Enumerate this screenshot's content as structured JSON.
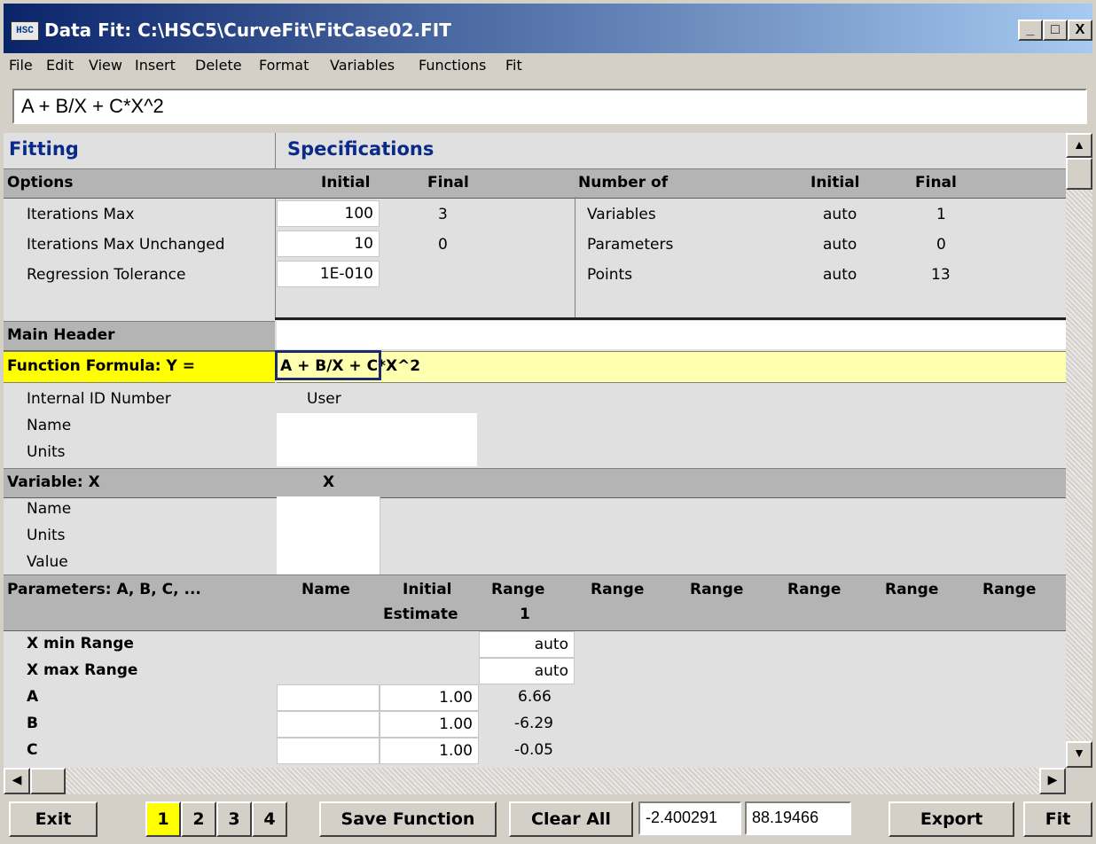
{
  "window": {
    "title": "Data Fit: C:\\HSC5\\CurveFit\\FitCase02.FIT",
    "app_icon": "HSC",
    "min": "_",
    "max": "□",
    "close": "X"
  },
  "menu": [
    "File",
    "Edit",
    "View",
    "Insert",
    "Delete",
    "Format",
    "Variables",
    "Functions",
    "Fit"
  ],
  "formula_bar": "A + B/X + C*X^2",
  "fitting": {
    "title_left": "Fitting",
    "title_right": "Specifications",
    "options_label": "Options",
    "col_initial": "Initial",
    "col_final": "Final",
    "rows": [
      {
        "label": "Iterations Max",
        "initial": "100",
        "final": "3"
      },
      {
        "label": "Iterations Max Unchanged",
        "initial": "10",
        "final": "0"
      },
      {
        "label": "Regression Tolerance",
        "initial": "1E-010",
        "final": ""
      }
    ],
    "number_of_label": "Number of",
    "number_rows": [
      {
        "label": "Variables",
        "initial": "auto",
        "final": "1"
      },
      {
        "label": "Parameters",
        "initial": "auto",
        "final": "0"
      },
      {
        "label": "Points",
        "initial": "auto",
        "final": "13"
      }
    ]
  },
  "main_header": {
    "label": "Main Header",
    "value": ""
  },
  "function": {
    "label": "Function Formula:  Y =",
    "formula": "A + B/X + C*X^2",
    "id_label": "Internal ID Number",
    "id_value": "User",
    "name_label": "Name",
    "units_label": "Units"
  },
  "variable": {
    "label": "Variable: X",
    "value": "X",
    "name_label": "Name",
    "units_label": "Units",
    "value_label": "Value"
  },
  "parameters": {
    "label": "Parameters: A, B, C, ...",
    "h_name": "Name",
    "h_initial": "Initial",
    "h_estimate": "Estimate",
    "h_range": "Range",
    "h_range_num": "1",
    "xmin_label": "X min Range",
    "xmin_value": "auto",
    "xmax_label": "X max Range",
    "xmax_value": "auto",
    "rows": [
      {
        "label": "A",
        "initial": "1.00",
        "range1": "6.66"
      },
      {
        "label": "B",
        "initial": "1.00",
        "range1": "-6.29"
      },
      {
        "label": "C",
        "initial": "1.00",
        "range1": "-0.05"
      }
    ]
  },
  "bottom": {
    "exit": "Exit",
    "pages": [
      "1",
      "2",
      "3",
      "4"
    ],
    "save": "Save Function",
    "clear": "Clear All",
    "field1": "-2.400291",
    "field2": "88.19466",
    "export": "Export",
    "fit": "Fit"
  }
}
